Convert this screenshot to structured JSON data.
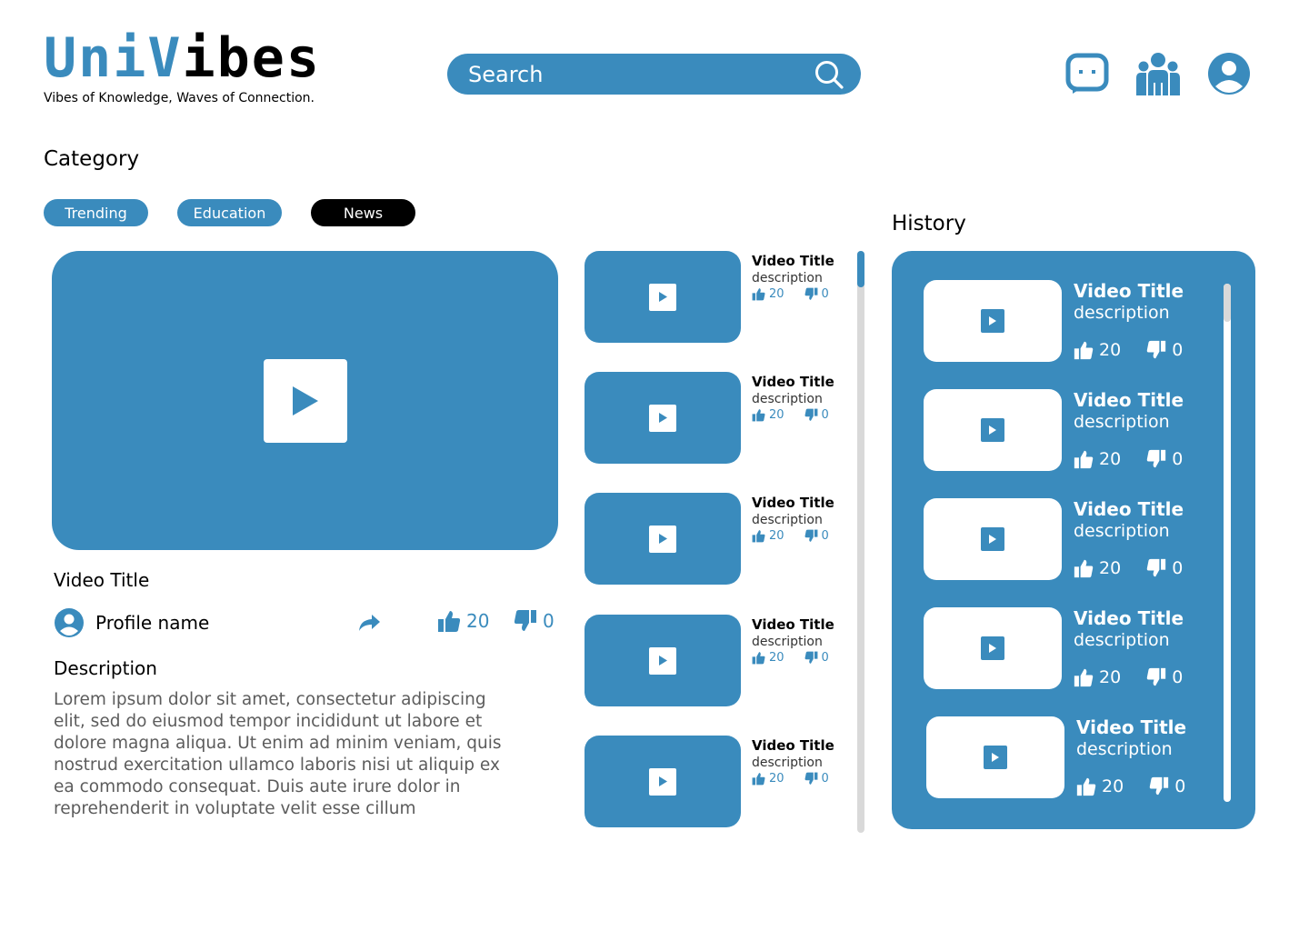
{
  "header": {
    "logo": {
      "part1": "Uni",
      "part2": "V",
      "part3": "ibes"
    },
    "tagline": "Vibes of Knowledge, Waves of Connection.",
    "search": {
      "placeholder": "Search"
    },
    "icons": [
      "chat-icon",
      "community-icon",
      "profile-icon"
    ]
  },
  "category": {
    "title": "Category",
    "chips": [
      {
        "label": "Trending",
        "active": false
      },
      {
        "label": "Education",
        "active": false
      },
      {
        "label": "News",
        "active": true
      }
    ]
  },
  "main_video": {
    "title": "Video Title",
    "profile_name": "Profile name",
    "likes": "20",
    "dislikes": "0",
    "description_title": "Description",
    "description_body": "Lorem ipsum dolor sit amet, consectetur adipiscing elit, sed do eiusmod tempor incididunt ut labore et dolore magna aliqua. Ut enim ad minim veniam, quis nostrud exercitation ullamco laboris nisi ut aliquip ex ea commodo consequat. Duis aute irure dolor in reprehenderit in voluptate velit esse cillum"
  },
  "related": [
    {
      "title": "Video Title",
      "description": "description",
      "likes": "20",
      "dislikes": "0"
    },
    {
      "title": "Video Title",
      "description": "description",
      "likes": "20",
      "dislikes": "0"
    },
    {
      "title": "Video Title",
      "description": "description",
      "likes": "20",
      "dislikes": "0"
    },
    {
      "title": "Video Title",
      "description": "description",
      "likes": "20",
      "dislikes": "0"
    },
    {
      "title": "Video Title",
      "description": "description",
      "likes": "20",
      "dislikes": "0"
    }
  ],
  "history": {
    "title": "History",
    "items": [
      {
        "title": "Video Title",
        "description": "description",
        "likes": "20",
        "dislikes": "0"
      },
      {
        "title": "Video Title",
        "description": "description",
        "likes": "20",
        "dislikes": "0"
      },
      {
        "title": "Video Title",
        "description": "description",
        "likes": "20",
        "dislikes": "0"
      },
      {
        "title": "Video Title",
        "description": "description",
        "likes": "20",
        "dislikes": "0"
      },
      {
        "title": "Video Title",
        "description": "description",
        "likes": "20",
        "dislikes": "0"
      }
    ]
  },
  "colors": {
    "accent": "#3a8bbd",
    "active_chip": "#000000",
    "scroll_track": "#d9d9d9"
  }
}
